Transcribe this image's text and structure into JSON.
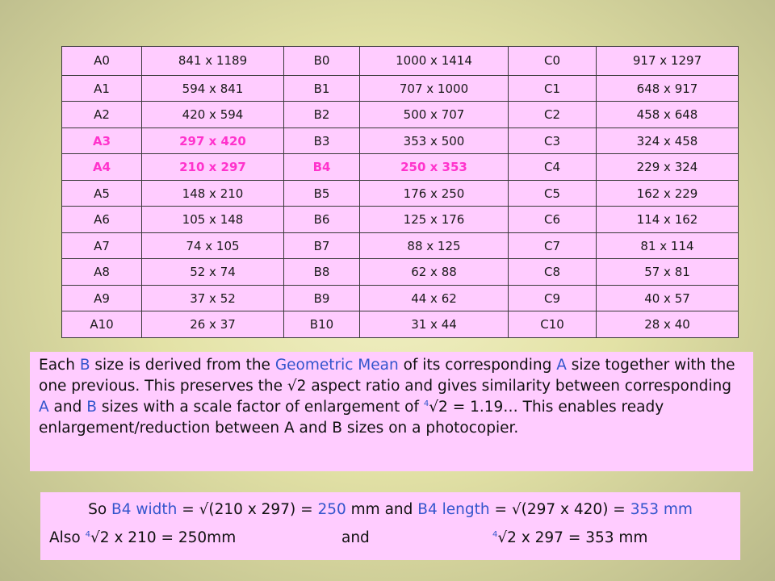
{
  "table": {
    "rows": [
      [
        "A0",
        "841 x 1189",
        "B0",
        "1000 x 1414",
        "C0",
        "917 x 1297"
      ],
      [
        "A1",
        "594 x 841",
        "B1",
        "707 x 1000",
        "C1",
        "648 x 917"
      ],
      [
        "A2",
        "420 x 594",
        "B2",
        "500 x 707",
        "C2",
        "458 x 648"
      ],
      [
        "A3",
        "297 x 420",
        "B3",
        "353 x 500",
        "C3",
        "324 x 458"
      ],
      [
        "A4",
        "210 x 297",
        "B4",
        "250 x 353",
        "C4",
        "229 x 324"
      ],
      [
        "A5",
        "148 x 210",
        "B5",
        "176 x 250",
        "C5",
        "162 x 229"
      ],
      [
        "A6",
        "105 x 148",
        "B6",
        "125 x 176",
        "C6",
        "114 x 162"
      ],
      [
        "A7",
        "74 x 105",
        "B7",
        "88 x 125",
        "C7",
        "81 x 114"
      ],
      [
        "A8",
        "52 x 74",
        "B8",
        "62 x 88",
        "C8",
        "57 x 81"
      ],
      [
        "A9",
        "37 x 52",
        "B9",
        "44 x 62",
        "C9",
        "40 x 57"
      ],
      [
        "A10",
        "26 x 37",
        "B10",
        "31 x 44",
        "C10",
        "28 x 40"
      ]
    ],
    "highlighted_cells": [
      "A3",
      "297 x 420",
      "A4",
      "210 x 297",
      "B4",
      "250 x 353"
    ],
    "highlight_color": "#ff33cc"
  },
  "explanation": {
    "t1": "Each ",
    "b_word": "B",
    "t2": " size is derived from the ",
    "geo_mean": "Geometric Mean",
    "t3": " of its corresponding ",
    "a_word": "A",
    "t4": " size together with the one previous. This preserves the √2 aspect ratio and  gives similarity between corresponding  ",
    "a_word2": "A",
    "t5": " and ",
    "b_word2": "B",
    "t6": " sizes with a scale factor of enlargement of ",
    "sup4": "4",
    "t7": "√2 = 1.19… This enables ready  enlargement/reduction between A and B sizes on a photocopier."
  },
  "formula": {
    "l1_t1": "So ",
    "l1_b4a": "B4 width",
    "l1_t2": " = √(210 x 297) = ",
    "l1_250": "250",
    "l1_t3": " mm and ",
    "l1_b4b": "B4 length",
    "l1_t4": " = √(297 x 420) = ",
    "l1_353": "353 mm",
    "l2_also": "Also ",
    "l2_sup1": "4",
    "l2_expr1": "√2 x 210 = 250mm",
    "l2_and": "and",
    "l2_sup2": "4",
    "l2_expr2": "√2 x 297 = 353 mm"
  },
  "colors": {
    "box_background": "#ffccff",
    "accent_blue": "#3355cc",
    "accent_pink": "#ff33cc"
  }
}
